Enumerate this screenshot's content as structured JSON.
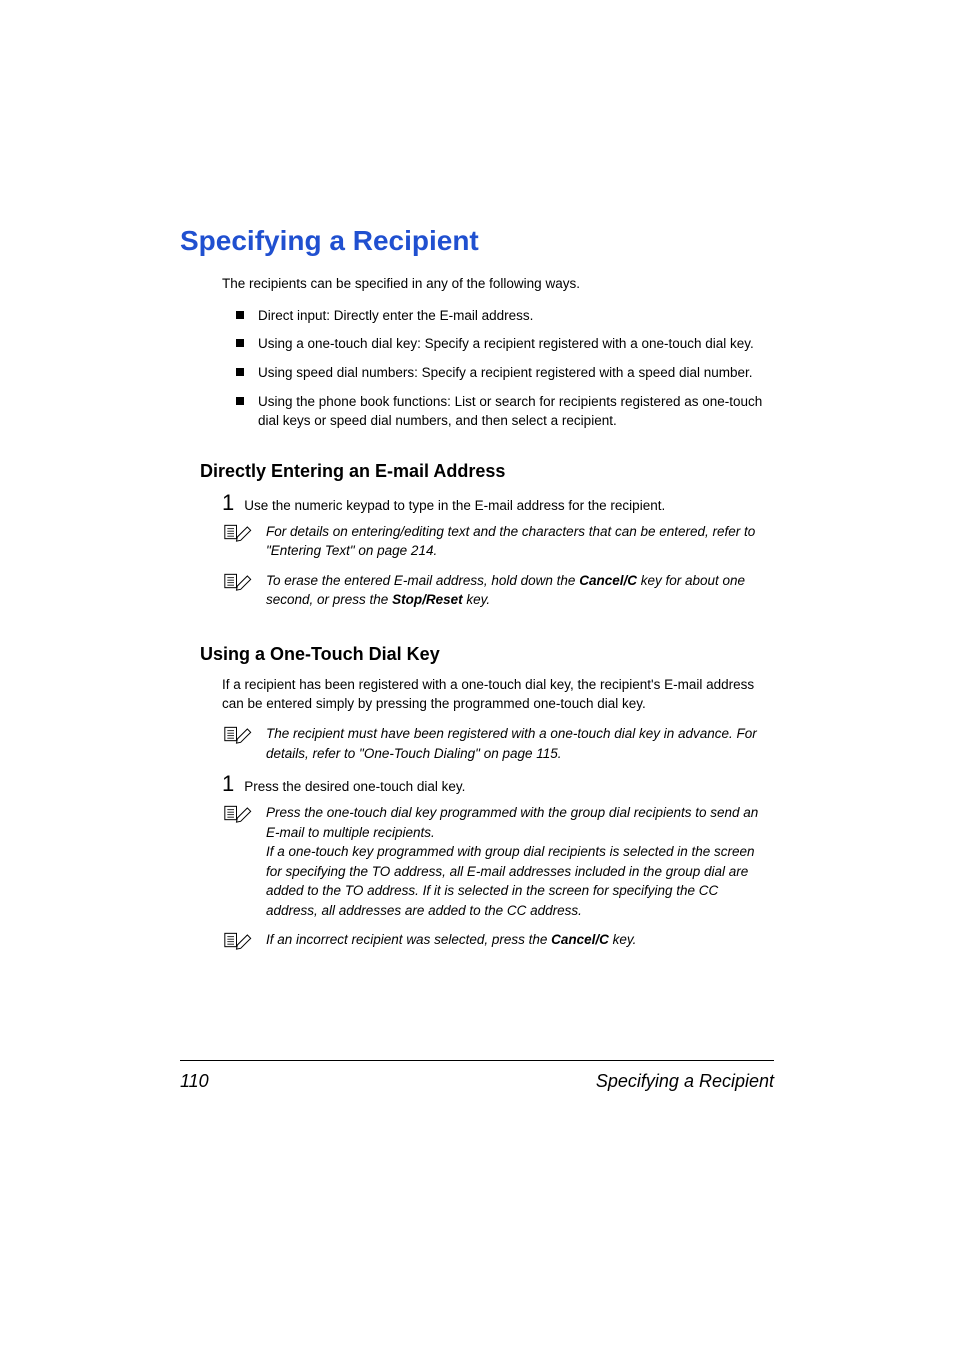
{
  "pageTitle": "Specifying a Recipient",
  "intro": "The recipients can be specified in any of the following ways.",
  "bullets": [
    "Direct input: Directly enter the E-mail address.",
    "Using a one-touch dial key: Specify a recipient registered with a one-touch dial key.",
    "Using speed dial numbers: Specify a recipient registered with a speed dial number.",
    "Using the phone book functions: List or search for recipients registered as one-touch dial keys or speed dial numbers, and then select a recipient."
  ],
  "section1": {
    "heading": "Directly Entering an E-mail Address",
    "step1Number": "1",
    "step1Text": "Use the numeric keypad to type in the E-mail address for the recipient.",
    "note1": "For details on entering/editing text and the characters that can be entered, refer to \"Entering Text\" on page 214.",
    "note2_pre": "To erase the entered E-mail address, hold down the ",
    "note2_bold1": "Cancel/C",
    "note2_mid": " key for about one second, or press the ",
    "note2_bold2": "Stop/Reset",
    "note2_post": " key."
  },
  "section2": {
    "heading": "Using a One-Touch Dial Key",
    "paragraph": "If a recipient has been registered with a one-touch dial key, the recipient's E-mail address can be entered simply by pressing the programmed one-touch dial key.",
    "note1": "The recipient must have been registered with a one-touch dial key in advance. For details, refer to \"One-Touch Dialing\" on page 115.",
    "step1Number": "1",
    "step1Text": "Press the desired one-touch dial key.",
    "note2": "Press the one-touch dial key programmed with the group dial recipients to send an E-mail to multiple recipients.\nIf a one-touch key programmed with group dial recipients is selected in the screen for specifying the TO address, all E-mail addresses included in the group dial are added to the TO address. If it is selected in the screen for specifying the CC address, all addresses are added to the CC address.",
    "note3_pre": "If an incorrect recipient was selected, press the ",
    "note3_bold": "Cancel/C",
    "note3_post": " key."
  },
  "footer": {
    "pageNumber": "110",
    "runningTitle": "Specifying a Recipient"
  }
}
